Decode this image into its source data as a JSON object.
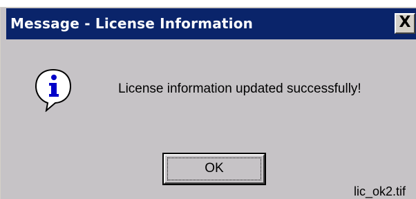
{
  "window": {
    "title": "Message - License Information",
    "close_glyph": "X"
  },
  "dialog": {
    "icon": "information-icon",
    "message": "License information updated successfully!",
    "ok_label": "OK"
  },
  "caption": {
    "filename": "lic_ok2.tif"
  },
  "colors": {
    "titlebar": "#0a246a",
    "dialog_bg": "#c6c3c6",
    "icon_blue": "#0000c8"
  }
}
